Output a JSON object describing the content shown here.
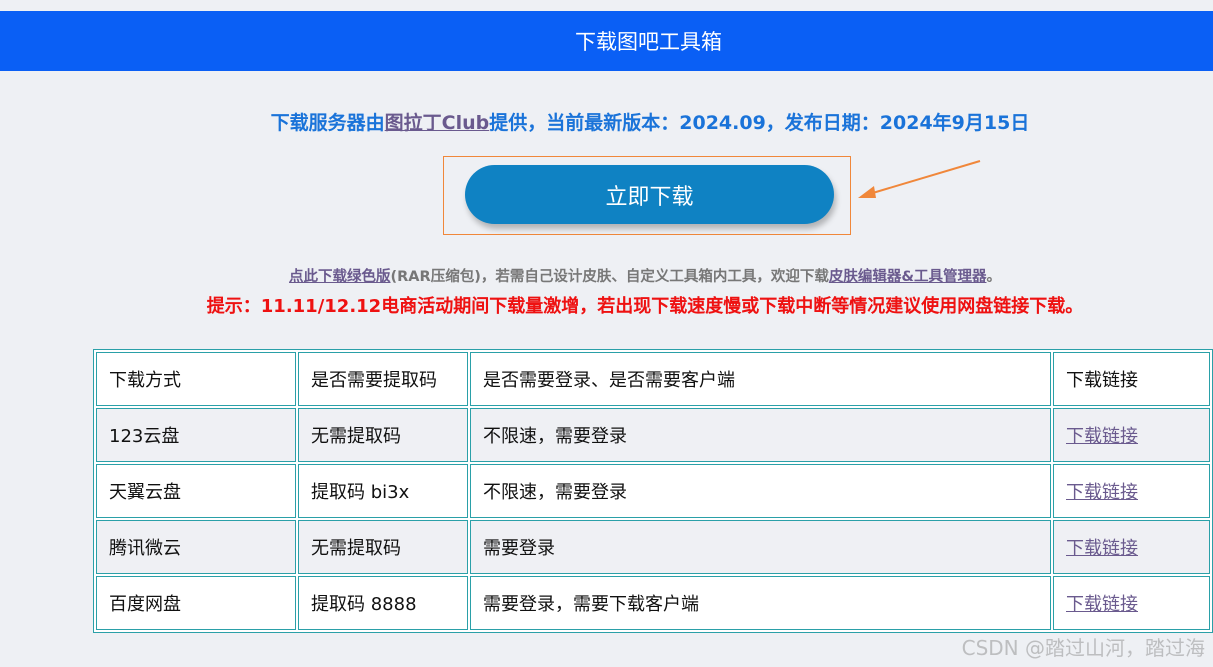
{
  "header": {
    "title": "下载图吧工具箱"
  },
  "release": {
    "prefix": "下载服务器由",
    "link_text": "图拉丁Club",
    "suffix": "提供，当前最新版本：2024.09，发布日期：2024年9月15日"
  },
  "download_button": {
    "label": "立即下载"
  },
  "green_version": {
    "link_text": "点此下载绿色版",
    "middle": "(RAR压缩包)，若需自己设计皮肤、自定义工具箱内工具，欢迎下载",
    "editor_link_text": "皮肤编辑器&工具管理器",
    "end": "。"
  },
  "tip": "提示：11.11/12.12电商活动期间下载量激增，若出现下载速度慢或下载中断等情况建议使用网盘链接下载。",
  "table": {
    "headers": [
      "下载方式",
      "是否需要提取码",
      "是否需要登录、是否需要客户端",
      "下载链接"
    ],
    "rows": [
      {
        "method": "123云盘",
        "code": "无需提取码",
        "requirement": "不限速，需要登录",
        "link": "下载链接"
      },
      {
        "method": "天翼云盘",
        "code": "提取码 bi3x",
        "requirement": "不限速，需要登录",
        "link": "下载链接"
      },
      {
        "method": "腾讯微云",
        "code": "无需提取码",
        "requirement": "需要登录",
        "link": "下载链接"
      },
      {
        "method": "百度网盘",
        "code": "提取码 8888",
        "requirement": "需要登录，需要下载客户端",
        "link": "下载链接"
      }
    ]
  },
  "watermark": "CSDN @踏过山河，踏过海",
  "colors": {
    "header_bg": "#0a5ff5",
    "button_bg": "#0f82c3",
    "highlight_border": "#f0873a",
    "tip_red": "#ee1111",
    "table_border": "#2aa0a8"
  }
}
